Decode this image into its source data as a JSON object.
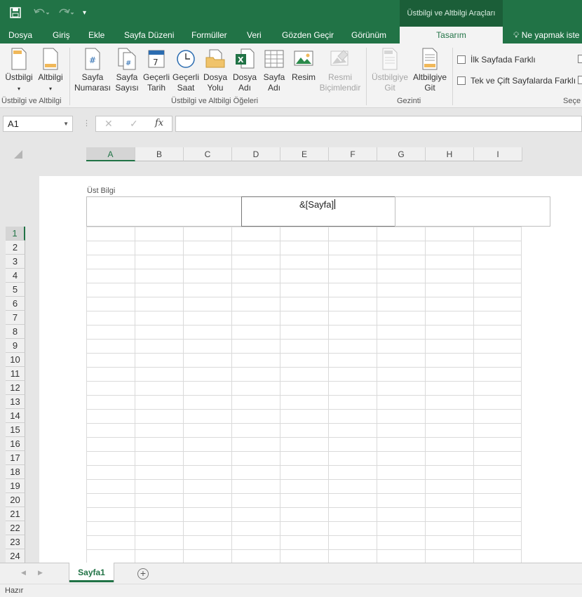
{
  "quick_access": {
    "save": "save-icon",
    "undo": "undo-icon",
    "redo": "redo-icon",
    "more": "▾"
  },
  "context_tab_title": "Üstbilgi ve Altbilgi Araçları",
  "tabs": [
    "Dosya",
    "Giriş",
    "Ekle",
    "Sayfa Düzeni",
    "Formüller",
    "Veri",
    "Gözden Geçir",
    "Görünüm",
    "Tasarım"
  ],
  "tell_me": "Ne yapmak iste",
  "ribbon": {
    "group1": {
      "label": "Üstbilgi ve Altbilgi",
      "buttons": [
        "Üstbilgi",
        "Altbilgi"
      ]
    },
    "group2": {
      "label": "Üstbilgi ve Altbilgi Öğeleri",
      "buttons": [
        {
          "l1": "Sayfa",
          "l2": "Numarası"
        },
        {
          "l1": "Sayfa",
          "l2": "Sayısı"
        },
        {
          "l1": "Geçerli",
          "l2": "Tarih"
        },
        {
          "l1": "Geçerli",
          "l2": "Saat"
        },
        {
          "l1": "Dosya",
          "l2": "Yolu"
        },
        {
          "l1": "Dosya",
          "l2": "Adı"
        },
        {
          "l1": "Sayfa",
          "l2": "Adı"
        },
        {
          "l1": "Resim",
          "l2": ""
        },
        {
          "l1": "Resmi",
          "l2": "Biçimlendir"
        }
      ]
    },
    "group3": {
      "label": "Gezinti",
      "buttons": [
        {
          "l1": "Üstbilgiye",
          "l2": "Git"
        },
        {
          "l1": "Altbilgiye",
          "l2": "Git"
        }
      ]
    },
    "options": {
      "first_page": "İlk Sayfada Farklı",
      "odd_even": "Tek ve Çift Sayfalarda Farklı",
      "group_label": "Seçe"
    }
  },
  "formula_bar": {
    "name_box": "A1",
    "cancel": "✕",
    "enter": "✓",
    "fx": "fx",
    "value": ""
  },
  "columns": [
    "A",
    "B",
    "C",
    "D",
    "E",
    "F",
    "G",
    "H",
    "I"
  ],
  "rows": [
    "1",
    "2",
    "3",
    "4",
    "5",
    "6",
    "7",
    "8",
    "9",
    "10",
    "11",
    "12",
    "13",
    "14",
    "15",
    "16",
    "17",
    "18",
    "19",
    "20",
    "21",
    "22",
    "23",
    "24"
  ],
  "header_area": {
    "label": "Üst Bilgi",
    "center_text": "&[Sayfa]"
  },
  "sheet_tabs": [
    "Sayfa1"
  ],
  "add_sheet": "+",
  "status": "Hazır",
  "colors": {
    "accent": "#217346",
    "context": "#1b5e38"
  }
}
